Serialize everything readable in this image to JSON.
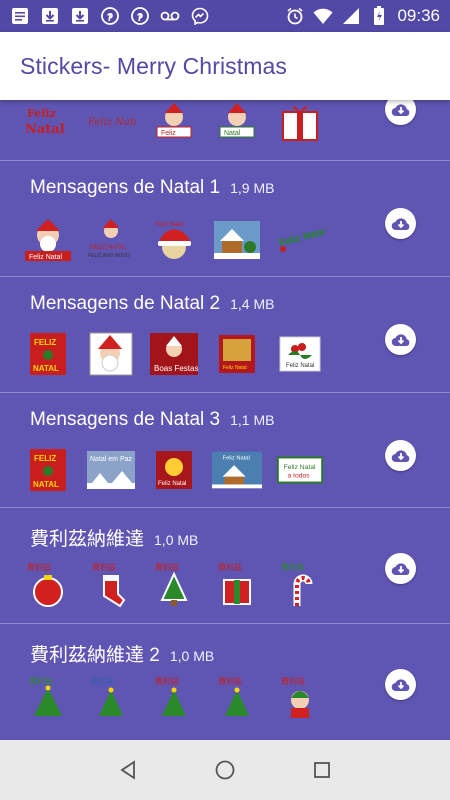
{
  "status_bar": {
    "time": "09:36",
    "icons": [
      "notes-icon",
      "download-icon",
      "download-icon",
      "pinterest-icon",
      "pinterest-icon",
      "voicemail-icon",
      "messenger-icon",
      "alarm-icon",
      "wifi-icon",
      "signal-icon",
      "battery-icon"
    ]
  },
  "app_bar": {
    "title": "Stickers- Merry Christmas"
  },
  "packs": [
    {
      "name": "",
      "size": "",
      "partial": true
    },
    {
      "name": "Mensagens de Natal 1",
      "size": "1,9 MB"
    },
    {
      "name": "Mensagens de Natal 2",
      "size": "1,4 MB"
    },
    {
      "name": "Mensagens de Natal 3",
      "size": "1,1 MB"
    },
    {
      "name": "費利茲納維達",
      "size": "1,0 MB"
    },
    {
      "name": "費利茲納維達 2",
      "size": "1,0 MB"
    }
  ],
  "colors": {
    "accent": "#5f55b3",
    "status_bar": "#5249a6",
    "title": "#5249a6"
  }
}
